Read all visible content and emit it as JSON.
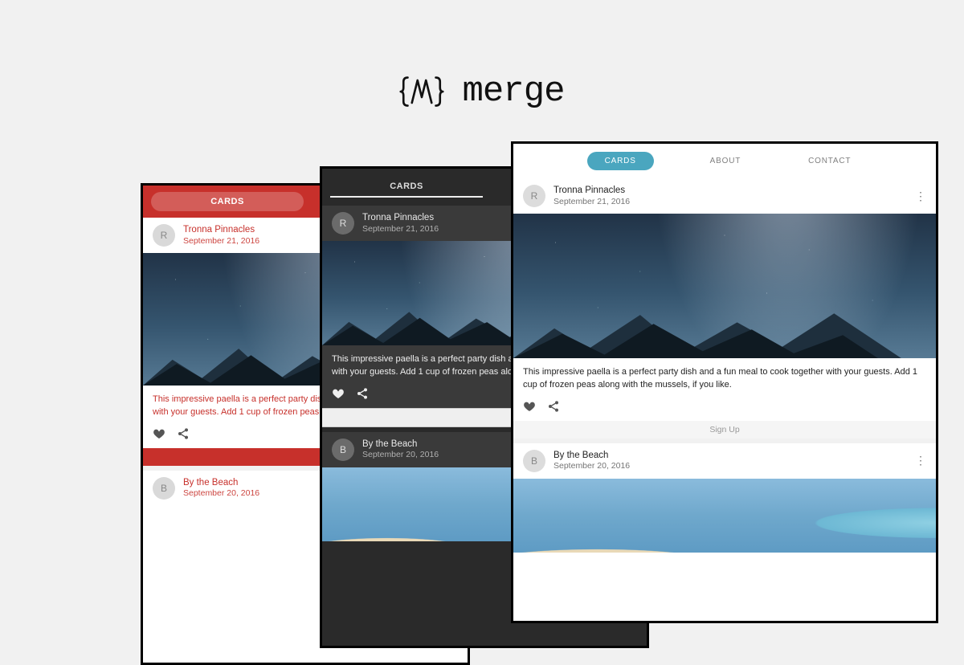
{
  "brand": {
    "name": "merge"
  },
  "tabs": {
    "cards": "CARDS",
    "about": "ABOUT",
    "contact": "CONTACT"
  },
  "card1": {
    "avatar_initial": "R",
    "title": "Tronna Pinnacles",
    "date": "September 21, 2016",
    "desc_full": "This impressive paella is a perfect party dish and a fun meal to cook together with your guests. Add 1 cup of frozen peas along with the mussels, if you like.",
    "desc_trunc": "This impressive paella is a perfect party dish and a fun meal to cook together with your guests. Add 1 cup of frozen peas along with the mussels, if you like."
  },
  "card2": {
    "avatar_initial": "B",
    "title": "By the Beach",
    "date": "September 20, 2016"
  },
  "signup": "Sign Up"
}
